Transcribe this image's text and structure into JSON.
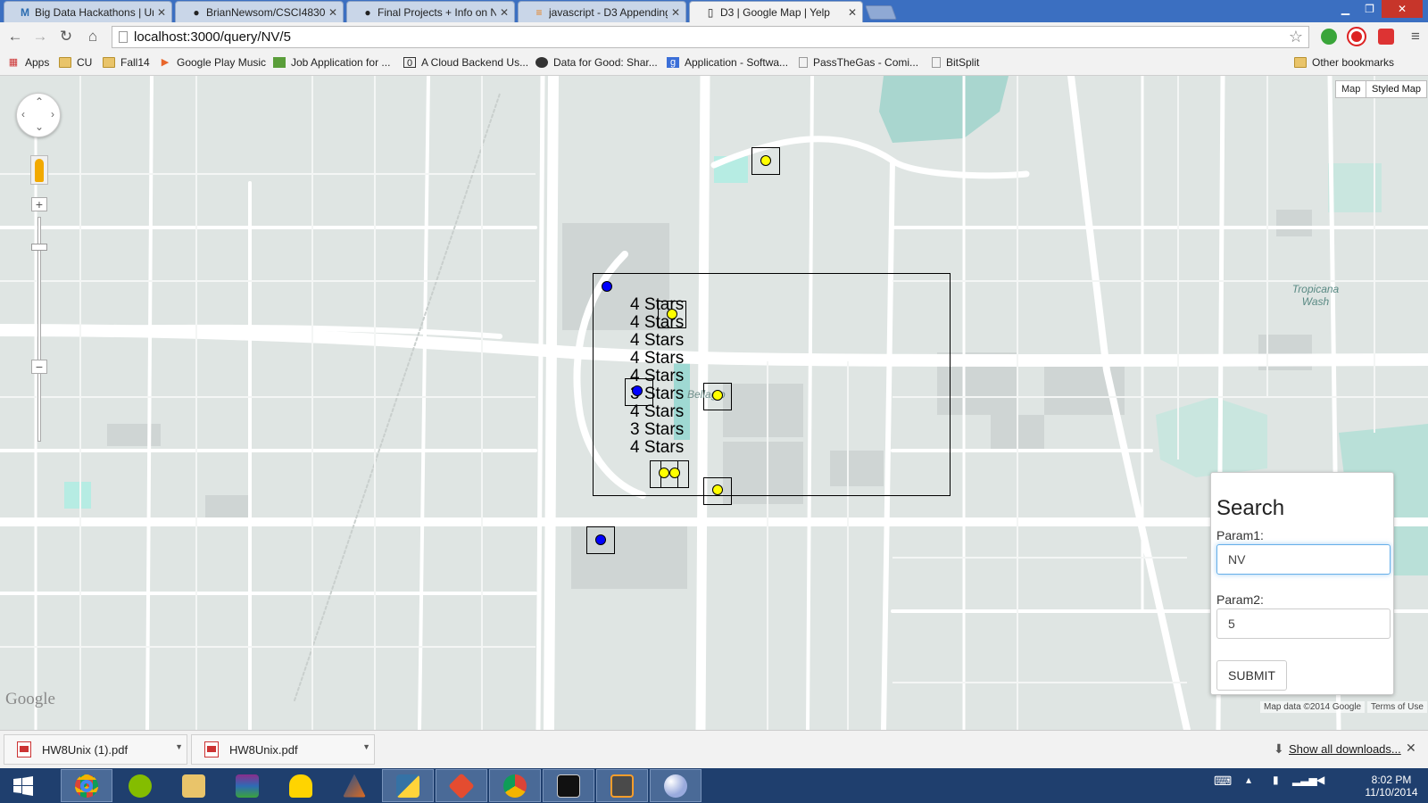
{
  "browser": {
    "tabs": [
      {
        "title": "Big Data Hackathons | Uni",
        "icon": "m-icon",
        "active": false
      },
      {
        "title": "BrianNewsom/CSCI4830-",
        "icon": "github-icon",
        "active": false
      },
      {
        "title": "Final Projects + Info on N",
        "icon": "github-icon",
        "active": false
      },
      {
        "title": "javascript - D3 Appending",
        "icon": "stackoverflow-icon",
        "active": false
      },
      {
        "title": "D3 | Google Map | Yelp",
        "icon": "page-icon",
        "active": true
      }
    ],
    "url": "localhost:3000/query/NV/5",
    "bookmarks": [
      {
        "label": "Apps",
        "icon": "apps-grid-icon"
      },
      {
        "label": "CU",
        "icon": "folder-icon"
      },
      {
        "label": "Fall14",
        "icon": "folder-icon"
      },
      {
        "label": "Google Play Music",
        "icon": "play-music-icon"
      },
      {
        "label": "Job Application for ...",
        "icon": "job-icon"
      },
      {
        "label": "A Cloud Backend Us...",
        "icon": "cloud-icon"
      },
      {
        "label": "Data for Good: Shar...",
        "icon": "globe-icon"
      },
      {
        "label": "Application - Softwa...",
        "icon": "g-icon"
      },
      {
        "label": "PassTheGas - Comi...",
        "icon": "page-icon"
      },
      {
        "label": "BitSplit",
        "icon": "page-icon"
      }
    ],
    "other_bookmarks": "Other bookmarks"
  },
  "map": {
    "type_buttons": [
      "Map",
      "Styled Map"
    ],
    "place_labels": [
      "Tropicana",
      "Wash",
      "Bellagio"
    ],
    "star_labels": [
      "4 Stars",
      "4 Stars",
      "4 Stars",
      "4 Stars",
      "4 Stars",
      "3 Stars",
      "4 Stars",
      "3 Stars",
      "4 Stars"
    ],
    "marker_colors": {
      "rating_high": "#ffff00",
      "rating_low": "#0000ff"
    },
    "google_logo": "Google",
    "map_data": "Map data ©2014 Google",
    "terms": "Terms of Use"
  },
  "search": {
    "title": "Search",
    "param1_label": "Param1:",
    "param1_value": "NV",
    "param2_label": "Param2:",
    "param2_value": "5",
    "submit_label": "SUBMIT"
  },
  "downloads": {
    "items": [
      "HW8Unix (1).pdf",
      "HW8Unix.pdf"
    ],
    "show_all": "Show all downloads..."
  },
  "taskbar": {
    "time": "8:02 PM",
    "date": "11/10/2014"
  }
}
